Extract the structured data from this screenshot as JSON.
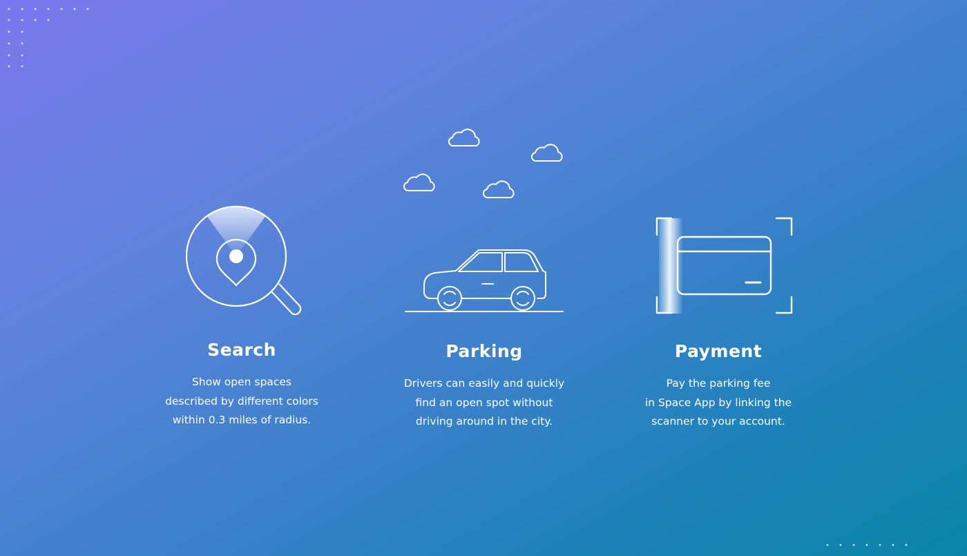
{
  "colors": {
    "gradient_start": "#7a78ee",
    "gradient_end": "#0a85a8",
    "icon_stroke": "#ffffff"
  },
  "features": [
    {
      "icon": "map-search-icon",
      "title": "Search",
      "lines": [
        "Show open spaces",
        "described by different colors",
        "within 0.3 miles of radius."
      ]
    },
    {
      "icon": "car-parking-icon",
      "title": "Parking",
      "lines": [
        "Drivers can easily and quickly",
        "find an open spot without",
        "driving around in the city."
      ]
    },
    {
      "icon": "card-scan-icon",
      "title": "Payment",
      "lines": [
        "Pay the parking fee",
        "in Space App by linking the",
        "scanner to your account."
      ]
    }
  ]
}
